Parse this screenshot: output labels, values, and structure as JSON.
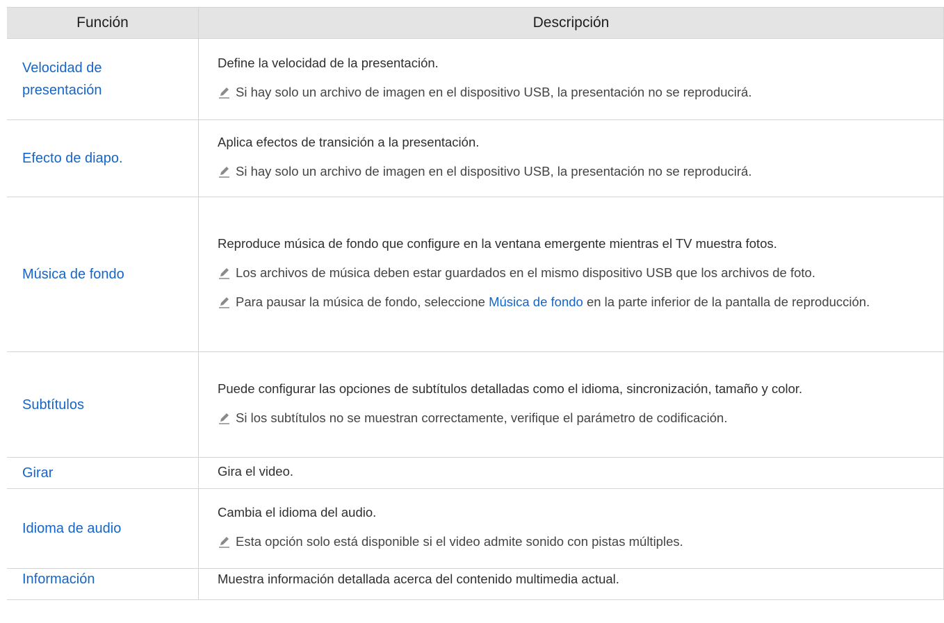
{
  "header": {
    "col_function": "Función",
    "col_description": "Descripción"
  },
  "rows": [
    {
      "function": "Velocidad de presentación",
      "description": "Define la velocidad de la presentación.",
      "note": "Si hay solo un archivo de imagen en el dispositivo USB, la presentación no se reproducirá."
    },
    {
      "function": "Efecto de diapo.",
      "description": "Aplica efectos de transición a la presentación.",
      "note": "Si hay solo un archivo de imagen en el dispositivo USB, la presentación no se reproducirá."
    },
    {
      "function": "Música de fondo",
      "description": "Reproduce música de fondo que configure en la ventana emergente mientras el TV muestra fotos.",
      "note1": "Los archivos de música deben estar guardados en el mismo dispositivo USB que los archivos de foto.",
      "note2_prefix": "Para pausar la música de fondo, seleccione ",
      "note2_link": "Música de fondo",
      "note2_suffix": " en la parte inferior de la pantalla de reproducción."
    },
    {
      "function": "Subtítulos",
      "description": "Puede configurar las opciones de subtítulos detalladas como el idioma, sincronización, tamaño y color.",
      "note": "Si los subtítulos no se muestran correctamente, verifique el parámetro de codificación."
    },
    {
      "function": "Girar",
      "description": "Gira el video."
    },
    {
      "function": "Idioma de audio",
      "description": "Cambia el idioma del audio.",
      "note": "Esta opción solo está disponible si el video admite sonido con pistas múltiples."
    },
    {
      "function": "Información",
      "description": "Muestra información detallada acerca del contenido multimedia actual."
    }
  ],
  "icons": {
    "note": "pencil-note-icon"
  },
  "colors": {
    "link": "#1565c9",
    "header_bg": "#e4e4e4",
    "border": "#d4d4d4",
    "note_icon": "#8a8a8a"
  }
}
